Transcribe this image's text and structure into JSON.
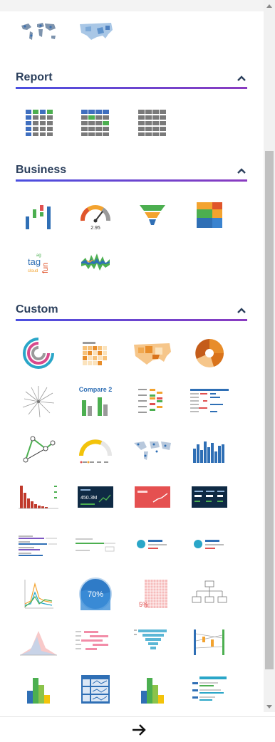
{
  "sections": {
    "report": {
      "title": "Report"
    },
    "business": {
      "title": "Business"
    },
    "custom": {
      "title": "Custom"
    }
  },
  "thumbnails": {
    "compare_title": "Compare 2",
    "gauge_value": "2.95",
    "tag_words": [
      "tag",
      "fun",
      "cloud",
      "ag"
    ],
    "percent_liquid": "70%",
    "percent_waffle": "5%",
    "number_card": "450.3M"
  },
  "colors": {
    "accent_start": "#4a4fe0",
    "accent_end": "#8a3bc0",
    "header_text": "#2b3f5c",
    "chart_blue": "#2f6fb5",
    "chart_green": "#4caf50",
    "chart_gray": "#8a8a8a"
  },
  "icons": [
    "chevron-up-icon",
    "arrow-right-icon"
  ]
}
